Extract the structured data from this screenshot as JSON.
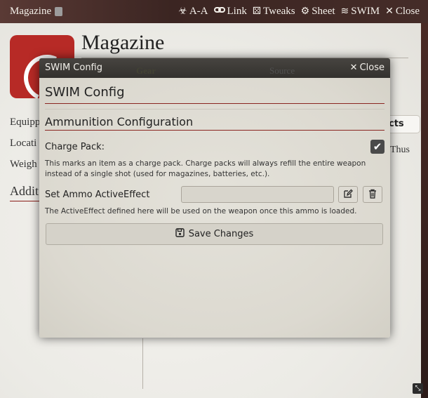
{
  "window": {
    "title": "Magazine",
    "controls": [
      {
        "icon": "biohazard-icon",
        "glyph": "☣",
        "label": "A-A"
      },
      {
        "icon": "link-icon",
        "glyph": "🔗",
        "label": "Link"
      },
      {
        "icon": "dice-icon",
        "glyph": "⚄",
        "label": "Tweaks"
      },
      {
        "icon": "gear-icon",
        "glyph": "⚙",
        "label": "Sheet"
      },
      {
        "icon": "swim-icon",
        "glyph": "≋",
        "label": "SWIM"
      },
      {
        "icon": "close-icon",
        "glyph": "✕",
        "label": "Close"
      }
    ]
  },
  "item": {
    "name": "Magazine",
    "labels": [
      "Equipp",
      "Locati",
      "Weigh"
    ],
    "additional": "Addit",
    "tab_partial": "cts",
    "text_partial": "Thus"
  },
  "dialog": {
    "title": "SWIM Config",
    "close_label": "Close",
    "ghost_gear": "Gear",
    "ghost_source": "Source",
    "header": "SWIM Config",
    "section": "Ammunition Configuration",
    "charge_pack": {
      "label": "Charge Pack:",
      "checked": true,
      "hint": "This marks an item as a charge pack. Charge packs will always refill the entire weapon instead of a single shot (used for magazines, batteries, etc.)."
    },
    "ammo_effect": {
      "label": "Set Ammo ActiveEffect",
      "value": "",
      "hint": "The ActiveEffect defined here will be used on the weapon once this ammo is loaded."
    },
    "save_label": "Save Changes"
  }
}
